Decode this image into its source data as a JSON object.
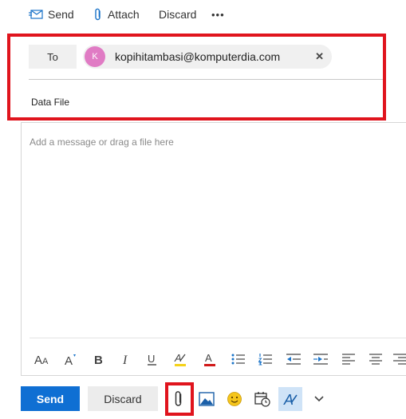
{
  "toolbar": {
    "send_label": "Send",
    "attach_label": "Attach",
    "discard_label": "Discard",
    "more_label": "•••"
  },
  "recipients": {
    "to_label": "To",
    "chips": [
      {
        "initial": "K",
        "email": "kopihitambasi@komputerdia.com",
        "remove": "✕",
        "avatar_color": "#e07bc4"
      }
    ]
  },
  "subject": {
    "value": "Data File"
  },
  "body": {
    "placeholder": "Add a message or drag a file here"
  },
  "format_toolbar": [
    "font-size-icon",
    "grow-font-icon",
    "bold-icon",
    "italic-icon",
    "underline-icon",
    "highlight-icon",
    "font-color-icon",
    "bullets-icon",
    "numbering-icon",
    "decrease-indent-icon",
    "increase-indent-icon",
    "align-left-icon",
    "align-center-icon",
    "align-right-icon"
  ],
  "bottom": {
    "send_label": "Send",
    "discard_label": "Discard",
    "icons": [
      "attach-icon",
      "insert-picture-icon",
      "emoji-icon",
      "schedule-icon",
      "format-icon",
      "more-chevron-icon"
    ]
  },
  "colors": {
    "accent": "#0f6fd3",
    "annotation": "#e0141d"
  }
}
